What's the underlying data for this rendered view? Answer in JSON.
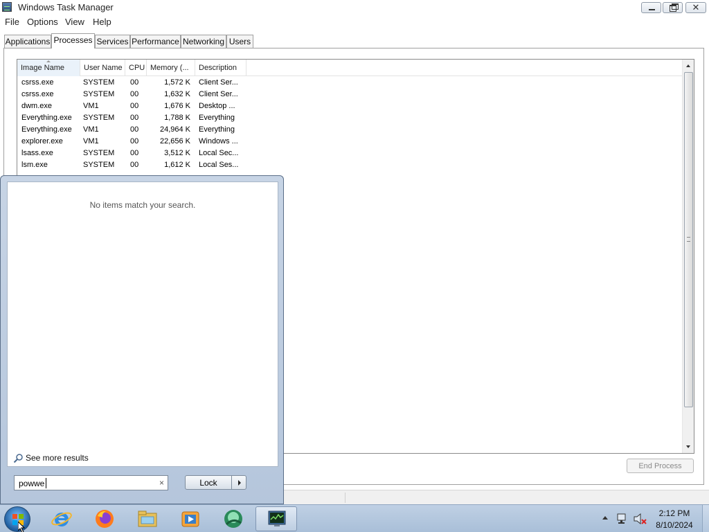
{
  "window": {
    "title": "Windows Task Manager"
  },
  "menu": [
    "File",
    "Options",
    "View",
    "Help"
  ],
  "tabs": [
    {
      "label": "Applications",
      "active": false
    },
    {
      "label": "Processes",
      "active": true
    },
    {
      "label": "Services",
      "active": false
    },
    {
      "label": "Performance",
      "active": false
    },
    {
      "label": "Networking",
      "active": false
    },
    {
      "label": "Users",
      "active": false
    }
  ],
  "table": {
    "columns": [
      "Image Name",
      "User Name",
      "CPU",
      "Memory (...",
      "Description"
    ],
    "rows": [
      [
        "csrss.exe",
        "SYSTEM",
        "00",
        "1,572 K",
        "Client Ser..."
      ],
      [
        "csrss.exe",
        "SYSTEM",
        "00",
        "1,632 K",
        "Client Ser..."
      ],
      [
        "dwm.exe",
        "VM1",
        "00",
        "1,676 K",
        "Desktop ..."
      ],
      [
        "Everything.exe",
        "SYSTEM",
        "00",
        "1,788 K",
        "Everything"
      ],
      [
        "Everything.exe",
        "VM1",
        "00",
        "24,964 K",
        "Everything"
      ],
      [
        "explorer.exe",
        "VM1",
        "00",
        "22,656 K",
        "Windows ..."
      ],
      [
        "lsass.exe",
        "SYSTEM",
        "00",
        "3,512 K",
        "Local Sec..."
      ],
      [
        "lsm.exe",
        "SYSTEM",
        "00",
        "1,612 K",
        "Local Ses..."
      ]
    ]
  },
  "buttons": {
    "end_process": "End Process"
  },
  "start_menu": {
    "no_results": "No items match your search.",
    "see_more": "See more results",
    "search_value": "powwe",
    "clear": "×",
    "lock": "Lock"
  },
  "taskbar": {
    "pinned_icons": [
      "internet-explorer-icon",
      "firefox-icon",
      "file-explorer-icon",
      "media-player-icon",
      "app-icon",
      "task-manager-icon"
    ],
    "time": "2:12 PM",
    "date": "8/10/2024"
  },
  "colors": {
    "taskbar": "#a9bfd8",
    "start_menu_frame": "#bfcde0",
    "selected_column": "#eaf2fa",
    "disabled_text": "#8a8a8a"
  }
}
